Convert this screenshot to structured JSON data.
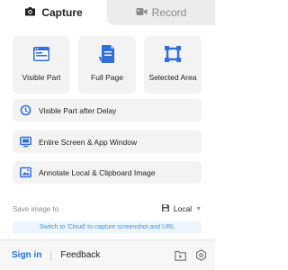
{
  "tabs": {
    "capture_label": "Capture",
    "record_label": "Record",
    "active": "Capture",
    "capture_icon": "camera-icon",
    "record_icon": "video-camera-icon"
  },
  "big_buttons": [
    {
      "label": "Visible Part",
      "icon": "browser-window-icon"
    },
    {
      "label": "Full Page",
      "icon": "scroll-page-icon"
    },
    {
      "label": "Selected Area",
      "icon": "crop-area-icon"
    }
  ],
  "row_buttons": [
    {
      "label": "Visible Part after Delay",
      "icon": "timer-icon"
    },
    {
      "label": "Entire Screen & App Window",
      "icon": "monitor-icon"
    },
    {
      "label": "Annotate Local & Clipboard Image",
      "icon": "image-edit-icon"
    }
  ],
  "save": {
    "label": "Save image to",
    "value": "Local",
    "icon": "floppy-disk-icon"
  },
  "hint": "Switch to 'Cloud' to capture screenshot and URL",
  "footer": {
    "signin": "Sign in",
    "feedback": "Feedback",
    "icons": [
      "folder-play-icon",
      "settings-icon"
    ]
  },
  "colors": {
    "accent": "#1a73e8",
    "icon_blue": "#2f6fde",
    "hint_text": "#4a90d9",
    "button_bg": "#f3f3f3"
  }
}
